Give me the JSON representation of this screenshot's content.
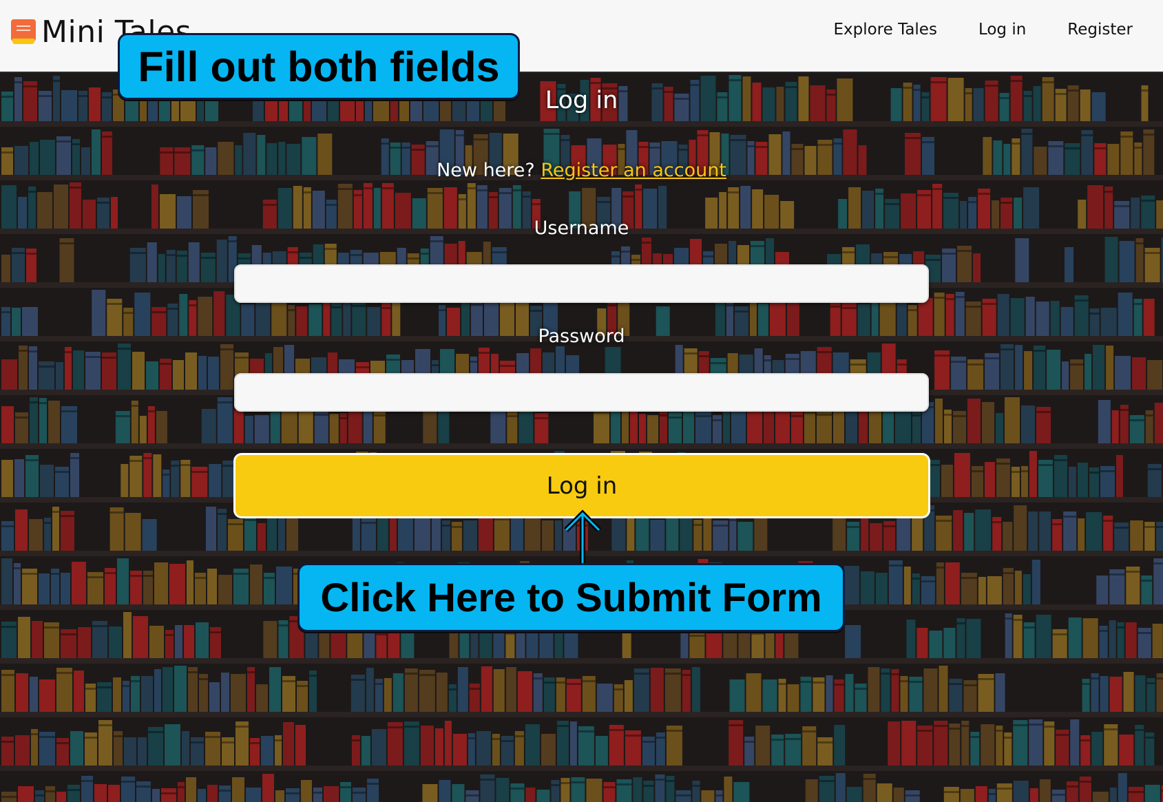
{
  "header": {
    "brand": "Mini Tales",
    "nav": [
      {
        "label": "Explore Tales"
      },
      {
        "label": "Log in"
      },
      {
        "label": "Register"
      }
    ]
  },
  "form": {
    "title": "Log in",
    "prompt": "New here?",
    "register_link": "Register an account",
    "username_label": "Username",
    "username_value": "",
    "password_label": "Password",
    "password_value": "",
    "submit_label": "Log in"
  },
  "callouts": {
    "top": "Fill out both fields",
    "bottom": "Click Here to Submit Form"
  },
  "colors": {
    "accent": "#f8cb10",
    "link": "#f9c515",
    "callout": "#05b6f2",
    "background": "#1d1919"
  },
  "icons": {
    "brand": "book-icon",
    "callout_arrow": "arrow-up-icon"
  }
}
